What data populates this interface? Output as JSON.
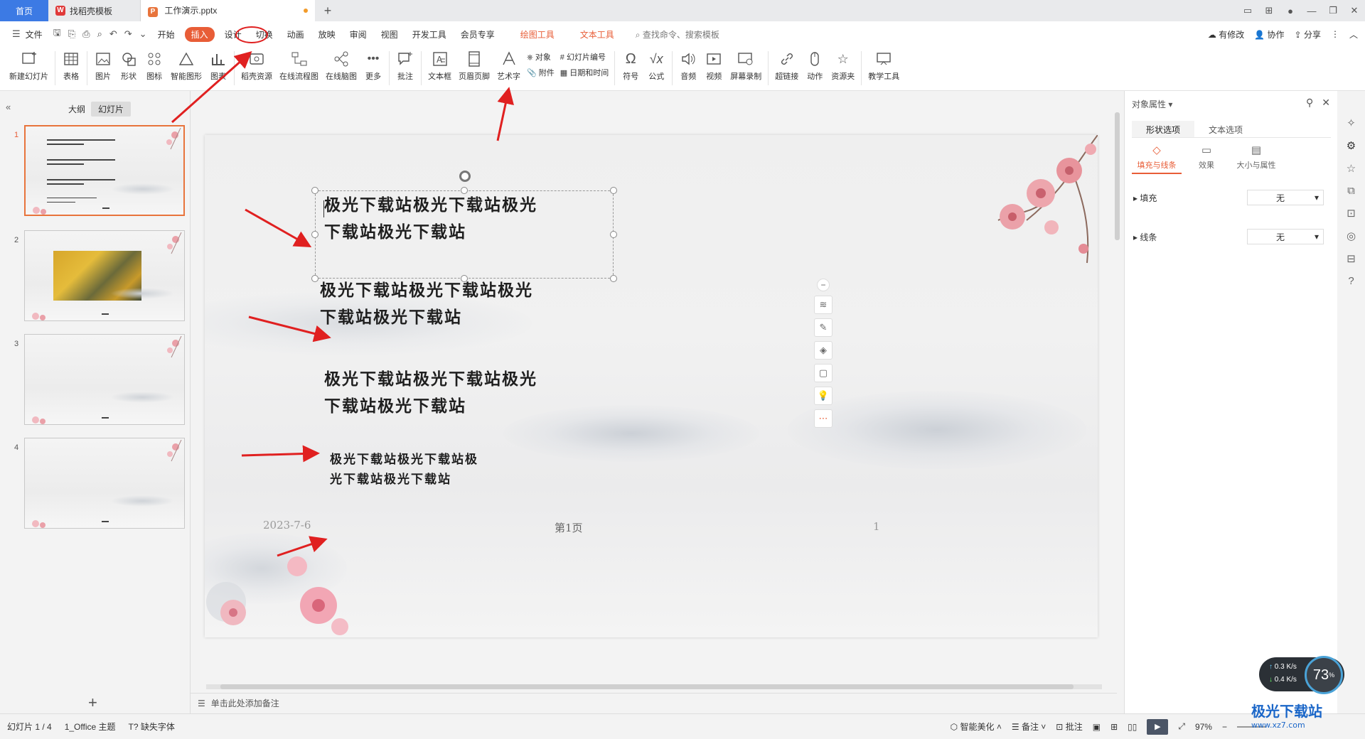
{
  "tabs": {
    "home": "首页",
    "template": "找稻壳模板",
    "doc": "工作演示.pptx"
  },
  "menu": {
    "file": "文件",
    "items": [
      "开始",
      "插入",
      "设计",
      "切换",
      "动画",
      "放映",
      "审阅",
      "视图",
      "开发工具",
      "会员专享"
    ],
    "active": "插入",
    "tools": [
      "绘图工具",
      "文本工具"
    ],
    "search": "查找命令、搜索模板",
    "right": [
      "有修改",
      "协作",
      "分享"
    ]
  },
  "ribbon": {
    "new_slide": "新建幻灯片",
    "table": "表格",
    "picture": "图片",
    "shape": "形状",
    "icon": "图标",
    "smart": "智能图形",
    "chart": "图表",
    "resource": "稻壳资源",
    "flow": "在线流程图",
    "mind": "在线脑图",
    "more": "更多",
    "comment": "批注",
    "textbox": "文本框",
    "header_footer": "页眉页脚",
    "wordart": "艺术字",
    "object": "对象",
    "attach": "附件",
    "slide_number": "幻灯片编号",
    "datetime": "日期和时间",
    "symbol": "符号",
    "formula": "公式",
    "audio": "音频",
    "video": "视频",
    "screen_rec": "屏幕录制",
    "hyperlink": "超链接",
    "action": "动作",
    "resource_box": "资源夹",
    "teach": "教学工具"
  },
  "left_panel": {
    "outline_tab": "大纲",
    "slides_tab": "幻灯片",
    "slide_numbers": [
      "1",
      "2",
      "3",
      "4"
    ]
  },
  "slide": {
    "texts": [
      {
        "line1": "极光下载站极光下载站极光",
        "line2": "下载站极光下载站"
      },
      {
        "line1": "极光下载站极光下载站极光",
        "line2": "下载站极光下载站"
      },
      {
        "line1": "极光下载站极光下载站极光",
        "line2": "下载站极光下载站"
      },
      {
        "line1": "极光下载站极光下载站极",
        "line2": "光下载站极光下载站"
      }
    ],
    "date": "2023-7-6",
    "page_label": "第1页",
    "page_num": "1"
  },
  "notes_placeholder": "单击此处添加备注",
  "right_pane": {
    "title": "对象属性",
    "tab_shape": "形状选项",
    "tab_text": "文本选项",
    "sub_fill": "填充与线条",
    "sub_effect": "效果",
    "sub_size": "大小与属性",
    "fill_label": "填充",
    "fill_value": "无",
    "line_label": "线条",
    "line_value": "无"
  },
  "status": {
    "slide_info": "幻灯片 1 / 4",
    "theme": "1_Office 主题",
    "missing_font": "缺失字体",
    "beautify": "智能美化",
    "notes": "备注",
    "comment": "批注",
    "zoom": "97%"
  },
  "speed": {
    "up": "0.3",
    "down": "0.4",
    "unit": "K/s",
    "percent": "73"
  },
  "watermark": {
    "name": "极光下载站",
    "url": "www.xz7.com"
  },
  "colors": {
    "accent": "#e85d37",
    "arrow": "#e02020",
    "home_tab": "#3c7ae4"
  }
}
